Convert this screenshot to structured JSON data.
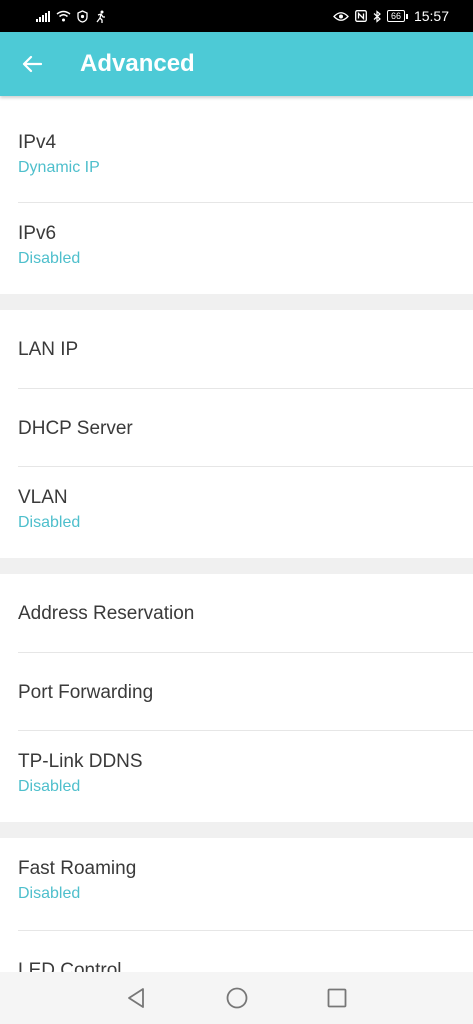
{
  "status_bar": {
    "time": "15:57",
    "battery": "66"
  },
  "header": {
    "title": "Advanced"
  },
  "sections": [
    {
      "items": [
        {
          "label": "IPv4",
          "value": "Dynamic IP"
        },
        {
          "label": "IPv6",
          "value": "Disabled"
        }
      ]
    },
    {
      "items": [
        {
          "label": "LAN IP"
        },
        {
          "label": "DHCP Server"
        },
        {
          "label": "VLAN",
          "value": "Disabled"
        }
      ]
    },
    {
      "items": [
        {
          "label": "Address Reservation"
        },
        {
          "label": "Port Forwarding"
        },
        {
          "label": "TP-Link DDNS",
          "value": "Disabled"
        }
      ]
    },
    {
      "items": [
        {
          "label": "Fast Roaming",
          "value": "Disabled"
        },
        {
          "label": "LED Control"
        }
      ]
    }
  ],
  "colors": {
    "accent": "#4dcad6",
    "value_text": "#4ebfcc"
  }
}
